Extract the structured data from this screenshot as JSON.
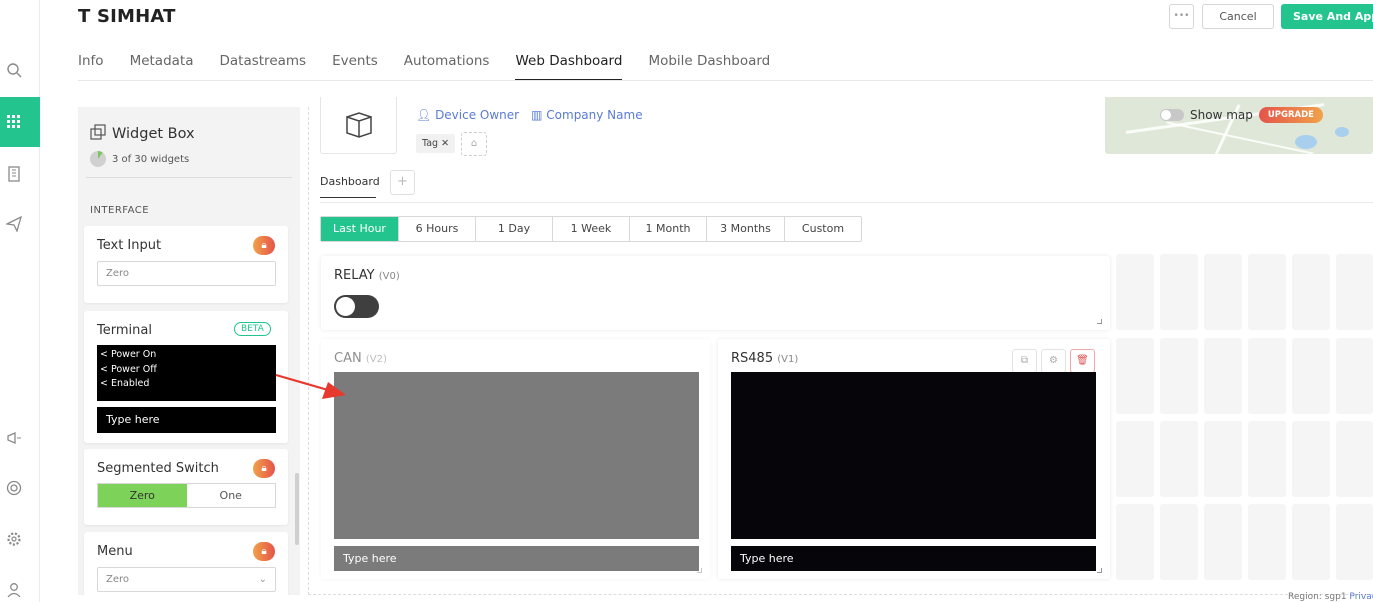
{
  "device": {
    "title": "T SIMHAT",
    "owner_label": "Device Owner",
    "company_label": "Company Name",
    "tag": "Tag"
  },
  "header": {
    "more_label": "•••",
    "cancel_label": "Cancel",
    "save_label": "Save And Apply"
  },
  "tabs": [
    {
      "label": "Info"
    },
    {
      "label": "Metadata"
    },
    {
      "label": "Datastreams"
    },
    {
      "label": "Events"
    },
    {
      "label": "Automations"
    },
    {
      "label": "Web Dashboard",
      "active": true
    },
    {
      "label": "Mobile Dashboard"
    }
  ],
  "widget_box": {
    "title": "Widget Box",
    "count": "3 of 30 widgets",
    "used_fraction": 0.1,
    "section": "INTERFACE",
    "widgets": {
      "text_input": {
        "name": "Text Input",
        "placeholder": "Zero"
      },
      "terminal": {
        "name": "Terminal",
        "badge": "BETA",
        "lines": [
          "< Power On",
          "< Power Off",
          "< Enabled"
        ],
        "input": "Type here"
      },
      "segmented": {
        "name": "Segmented Switch",
        "options": [
          "Zero",
          "One"
        ],
        "selected": "Zero"
      },
      "menu": {
        "name": "Menu",
        "value": "Zero"
      }
    }
  },
  "map": {
    "show_map": "Show map",
    "upgrade": "UPGRADE"
  },
  "dashboard_tab": "Dashboard",
  "ranges": [
    "Last Hour",
    "6 Hours",
    "1 Day",
    "1 Week",
    "1 Month",
    "3 Months",
    "Custom"
  ],
  "selected_range": "Last Hour",
  "widgets": {
    "relay": {
      "name": "RELAY",
      "pin": "(V0)",
      "state": "off"
    },
    "can": {
      "name": "CAN",
      "pin": "(V2)",
      "input": "Type here"
    },
    "rs485": {
      "name": "RS485",
      "pin": "(V1)",
      "input": "Type here"
    }
  },
  "footer": {
    "region": "Region: sgp1",
    "privacy": "Privacy"
  },
  "colors": {
    "accent": "#23c48e",
    "link": "#5a7bd6",
    "terminal_bg": "#000000"
  }
}
